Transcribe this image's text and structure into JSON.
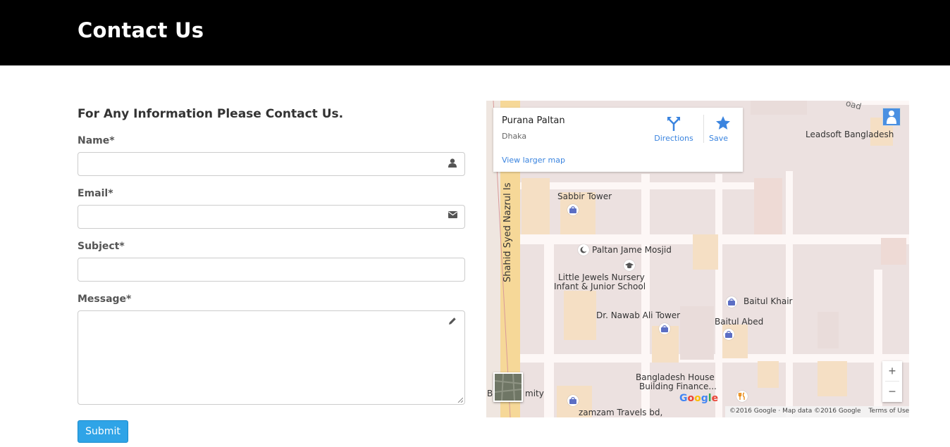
{
  "header": {
    "title": "Contact Us"
  },
  "form": {
    "intro": "For Any Information Please Contact Us.",
    "name_label": "Name*",
    "email_label": "Email*",
    "subject_label": "Subject*",
    "message_label": "Message*",
    "name_value": "",
    "email_value": "",
    "subject_value": "",
    "message_value": "",
    "submit_label": "Submit",
    "button_color": "#2fa4e7"
  },
  "map": {
    "place_name": "Purana Paltan",
    "place_city": "Dhaka",
    "view_larger": "View larger map",
    "directions_label": "Directions",
    "save_label": "Save",
    "labels": {
      "leadsoft": "Leadsoft Bangladesh",
      "sabbir": "Sabbir Tower",
      "mosjid": "Paltan Jame Mosjid",
      "nursery_1": "Little Jewels Nursery",
      "nursery_2": "Infant & Junior School",
      "baitul_khair": "Baitul Khair",
      "nawab": "Dr. Nawab Ali Tower",
      "baitul_abed": "Baitul Abed",
      "bd_house_1": "Bangladesh House",
      "bd_house_2": "Building Finance...",
      "zamzam": "zamzam Travels bd,",
      "shahid_road": "Shahid Syed Nazrul Is",
      "road_corner": "oad",
      "bottom_left": "B",
      "bottom_left_2": "mity"
    },
    "google": "Google",
    "attribution": "©2016 Google · Map data ©2016 Google",
    "terms": "Terms of Use",
    "zoom_in": "+",
    "zoom_out": "−",
    "accent_color": "#3a84df"
  }
}
